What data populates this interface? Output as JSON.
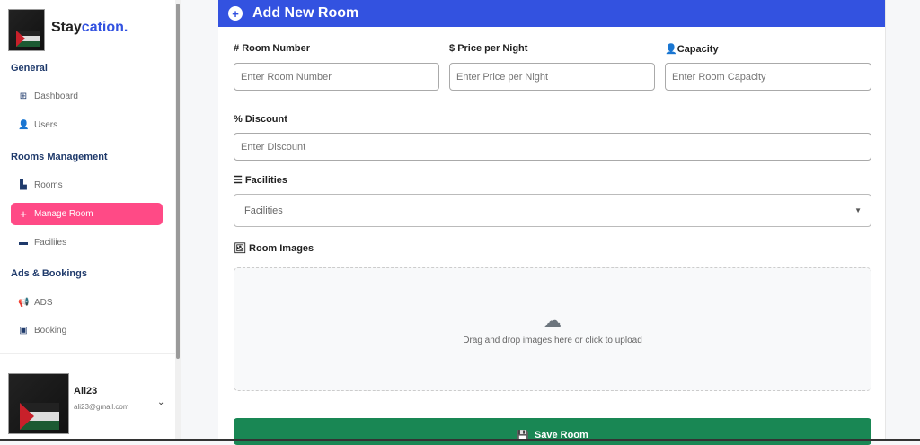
{
  "brand": {
    "name_a": "Stay",
    "name_b": "cation."
  },
  "sidebar": {
    "sections": [
      "General",
      "Rooms Management",
      "Ads & Bookings"
    ],
    "items": [
      {
        "label": "Dashboard",
        "icon": "grid-icon"
      },
      {
        "label": "Users",
        "icon": "user-icon"
      },
      {
        "label": "Rooms",
        "icon": "door-icon"
      },
      {
        "label": "Manage Room",
        "icon": "plus-icon"
      },
      {
        "label": "Faciliies",
        "icon": "bed-icon"
      },
      {
        "label": "ADS",
        "icon": "megaphone-icon"
      },
      {
        "label": "Booking",
        "icon": "calendar-check-icon"
      }
    ]
  },
  "user": {
    "name": "Ali23",
    "email": "ali23@gmail.com"
  },
  "form": {
    "title": "Add New Room",
    "room_number": {
      "label": "Room Number",
      "placeholder": "Enter Room Number"
    },
    "price": {
      "label": "Price per Night",
      "placeholder": "Enter Price per Night"
    },
    "capacity": {
      "label": "Capacity",
      "placeholder": "Enter Room Capacity"
    },
    "discount": {
      "label": "Discount",
      "placeholder": "Enter Discount"
    },
    "facilities": {
      "label": "Facilities",
      "placeholder": "Facilities"
    },
    "images": {
      "label": "Room Images",
      "drop_text": "Drag and drop images here or click to upload"
    },
    "save_label": "Save Room"
  },
  "colors": {
    "primary": "#3352e0",
    "active": "#ff4a86",
    "save": "#198754"
  }
}
